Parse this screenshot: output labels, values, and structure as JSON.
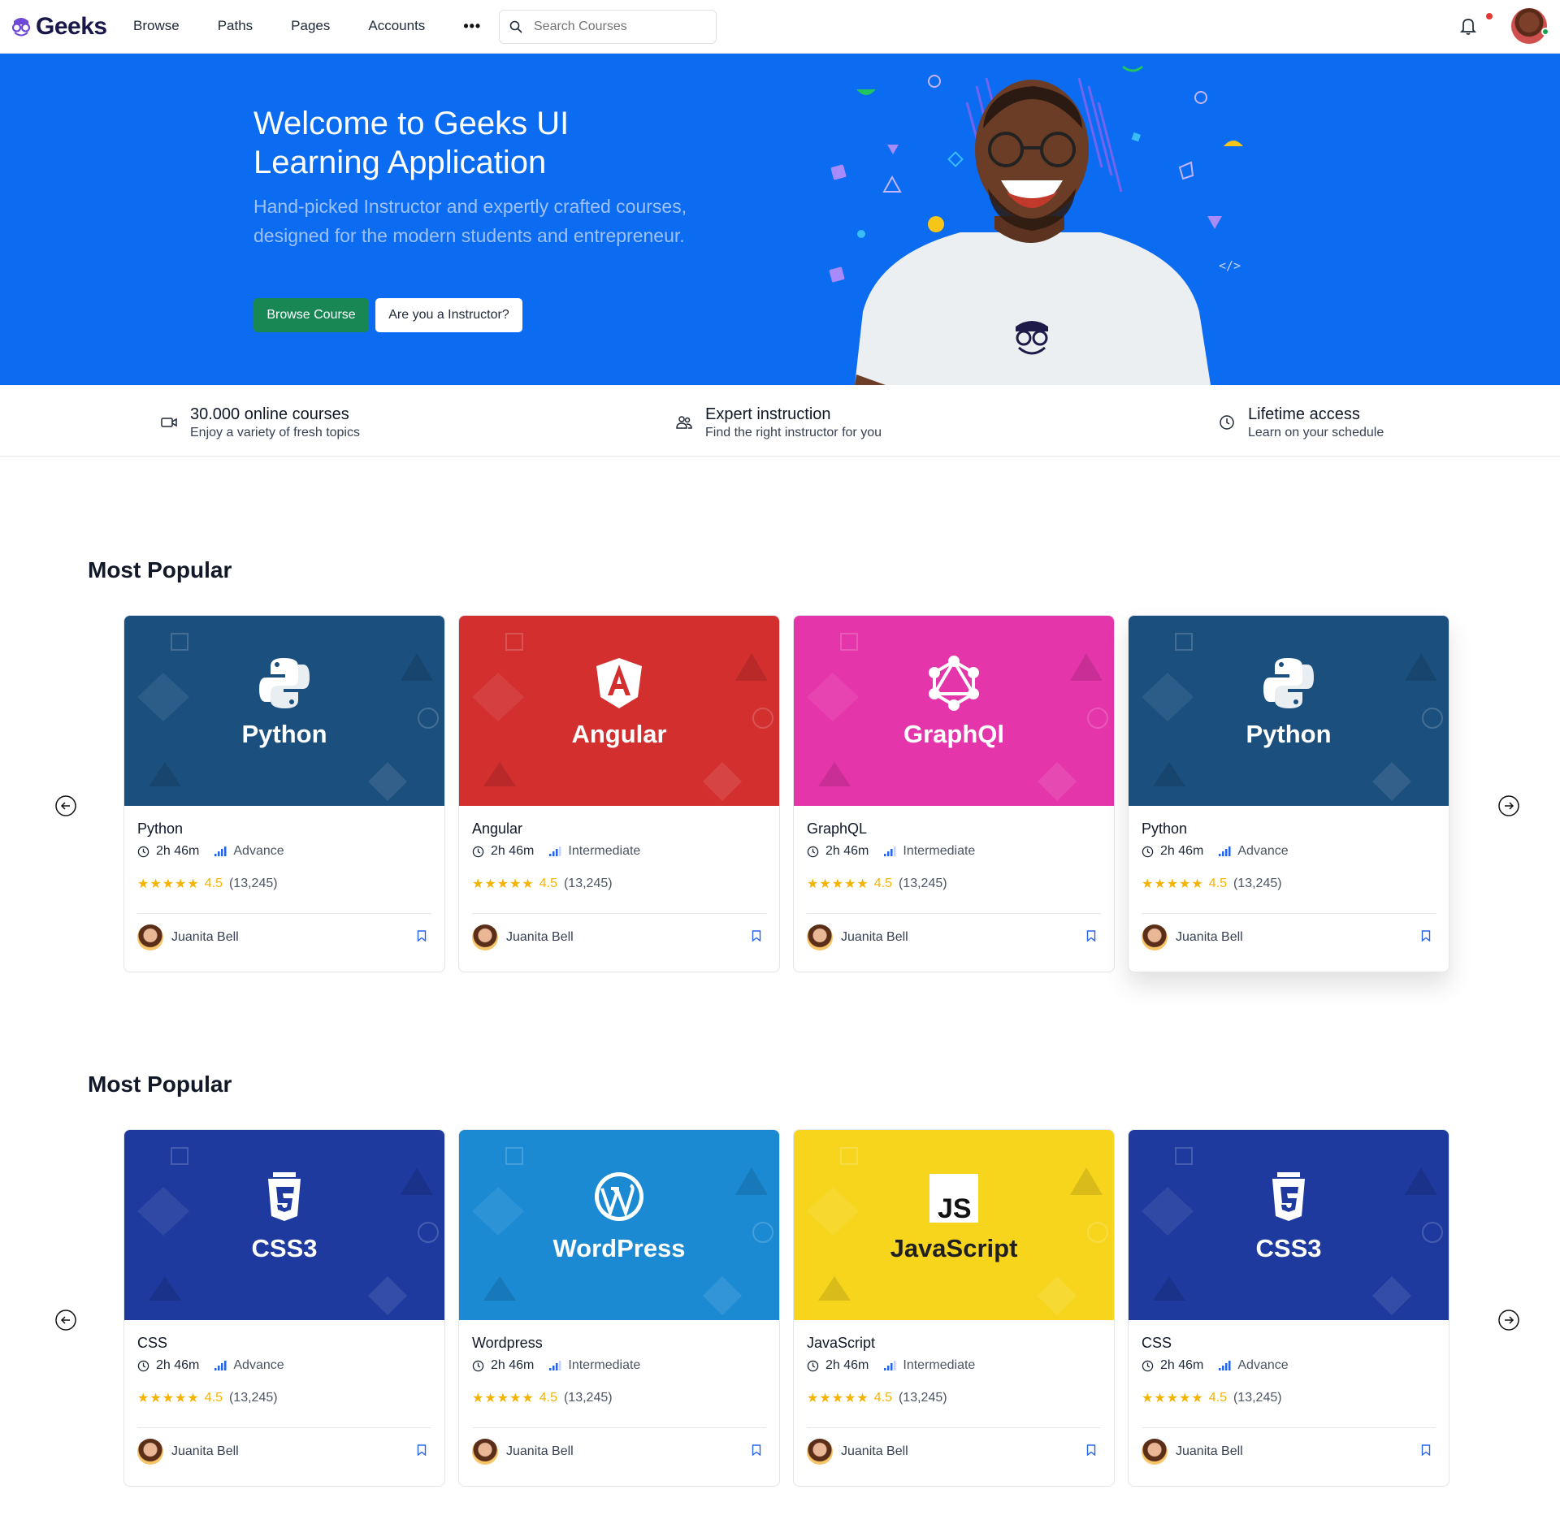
{
  "nav": {
    "logo": "Geeks",
    "menu": [
      "Browse",
      "Paths",
      "Pages",
      "Accounts"
    ],
    "search_placeholder": "Search Courses"
  },
  "hero": {
    "title": "Welcome to Geeks UI Learning Application",
    "subtitle": "Hand-picked Instructor and expertly crafted courses, designed for the modern students and entrepreneur.",
    "primary_button": "Browse Course",
    "secondary_button": "Are you a Instructor?"
  },
  "features": [
    {
      "icon": "video-icon",
      "title": "30.000 online courses",
      "subtitle": "Enjoy a variety of fresh topics"
    },
    {
      "icon": "users-icon",
      "title": "Expert instruction",
      "subtitle": "Find the right instructor for you"
    },
    {
      "icon": "clock-icon",
      "title": "Lifetime access",
      "subtitle": "Learn on your schedule"
    }
  ],
  "sections": [
    {
      "title": "Most Popular",
      "cards": [
        {
          "thumb_label": "Python",
          "thumb_color": "#1b4f7e",
          "title": "Python",
          "duration": "2h 46m",
          "level": "Advance",
          "stars": "★★★★★",
          "rating": "4.5",
          "reviews": "(13,245)",
          "author": "Juanita Bell"
        },
        {
          "thumb_label": "Angular",
          "thumb_color": "#d32f2f",
          "title": "Angular",
          "duration": "2h 46m",
          "level": "Intermediate",
          "stars": "★★★★★",
          "rating": "4.5",
          "reviews": "(13,245)",
          "author": "Juanita Bell"
        },
        {
          "thumb_label": "GraphQl",
          "thumb_color": "#e535ab",
          "title": "GraphQL",
          "duration": "2h 46m",
          "level": "Intermediate",
          "stars": "★★★★★",
          "rating": "4.5",
          "reviews": "(13,245)",
          "author": "Juanita Bell"
        },
        {
          "thumb_label": "Python",
          "thumb_color": "#1b4f7e",
          "title": "Python",
          "duration": "2h 46m",
          "level": "Advance",
          "stars": "★★★★★",
          "rating": "4.5",
          "reviews": "(13,245)",
          "author": "Juanita Bell"
        }
      ]
    },
    {
      "title": "Most Popular",
      "cards": [
        {
          "thumb_label": "CSS3",
          "thumb_color": "#1e3a9e",
          "title": "CSS",
          "duration": "2h 46m",
          "level": "Advance",
          "stars": "★★★★★",
          "rating": "4.5",
          "reviews": "(13,245)",
          "author": "Juanita Bell"
        },
        {
          "thumb_label": "WordPress",
          "thumb_color": "#1b8ad3",
          "title": "Wordpress",
          "duration": "2h 46m",
          "level": "Intermediate",
          "stars": "★★★★★",
          "rating": "4.5",
          "reviews": "(13,245)",
          "author": "Juanita Bell"
        },
        {
          "thumb_label": "JavaScript",
          "thumb_color": "#f7d51d",
          "title": "JavaScript",
          "duration": "2h 46m",
          "level": "Intermediate",
          "stars": "★★★★★",
          "rating": "4.5",
          "reviews": "(13,245)",
          "author": "Juanita Bell"
        },
        {
          "thumb_label": "CSS3",
          "thumb_color": "#1e3a9e",
          "title": "CSS",
          "duration": "2h 46m",
          "level": "Advance",
          "stars": "★★★★★",
          "rating": "4.5",
          "reviews": "(13,245)",
          "author": "Juanita Bell"
        }
      ]
    }
  ],
  "colors": {
    "hero_bg": "#0b6cf2",
    "primary_button": "#198754",
    "star": "#f5b301",
    "level_icon": "#2563eb"
  }
}
